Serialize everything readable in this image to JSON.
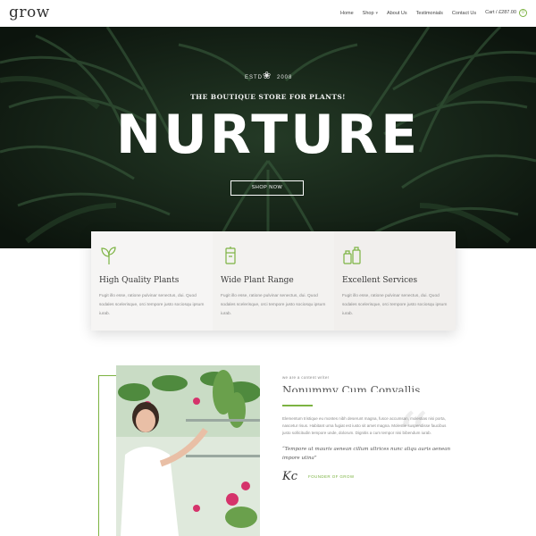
{
  "header": {
    "logo_text": "grow",
    "nav": [
      {
        "label": "Home"
      },
      {
        "label": "Shop"
      },
      {
        "label": "About Us"
      },
      {
        "label": "Testimonials"
      },
      {
        "label": "Contact Us"
      }
    ],
    "cart_label": "Cart / £287.00",
    "cart_count": "0"
  },
  "hero": {
    "estd_left": "ESTD",
    "estd_right": "2008",
    "tagline": "THE BOUTIQUE STORE FOR PLANTS!",
    "title": "NURTURE",
    "button_label": "SHOP NOW"
  },
  "features": [
    {
      "icon": "sprout-icon",
      "title": "High Quality Plants",
      "text": "Fugit illo esse, ratione pulvinar senectus, dui. Quod sodales scelerisque, orci tempore justo sociosqu ipsum iurab."
    },
    {
      "icon": "plant-pot-icon",
      "title": "Wide Plant Range",
      "text": "Fugit illo esse, ratione pulvinar senectus, dui. Quod sodales scelerisque, orci tempore justo sociosqu ipsum iurab."
    },
    {
      "icon": "watering-can-icon",
      "title": "Excellent Services",
      "text": "Fugit illo esse, ratione pulvinar senectus, dui. Quod sodales scelerisque, orci tempore justo sociosqu ipsum iurab."
    }
  ],
  "about": {
    "kicker": "we are a content writer",
    "title": "Nonummy Cum Convallis",
    "body": "Elementum tristique eu montes nibh deserunt magna, fusce accumsan, molestias nisi porta, nascetur risus. Habitant urna fugiat est iusto sit amet magna. Molestie suspendisse faucibus justo sollicitudin tempore unde, dolorum. Dignitis a cum tempor nisi bibendum iurab.",
    "quote": "“Tempore ut mauris aenean cillum ultrices nunc aliqu auris aenean impore utina”",
    "signature": "Kc",
    "founder_label": "FOUNDER OF GROW"
  },
  "colors": {
    "accent": "#7cb342",
    "hero_bg": "#1a2a1c"
  }
}
